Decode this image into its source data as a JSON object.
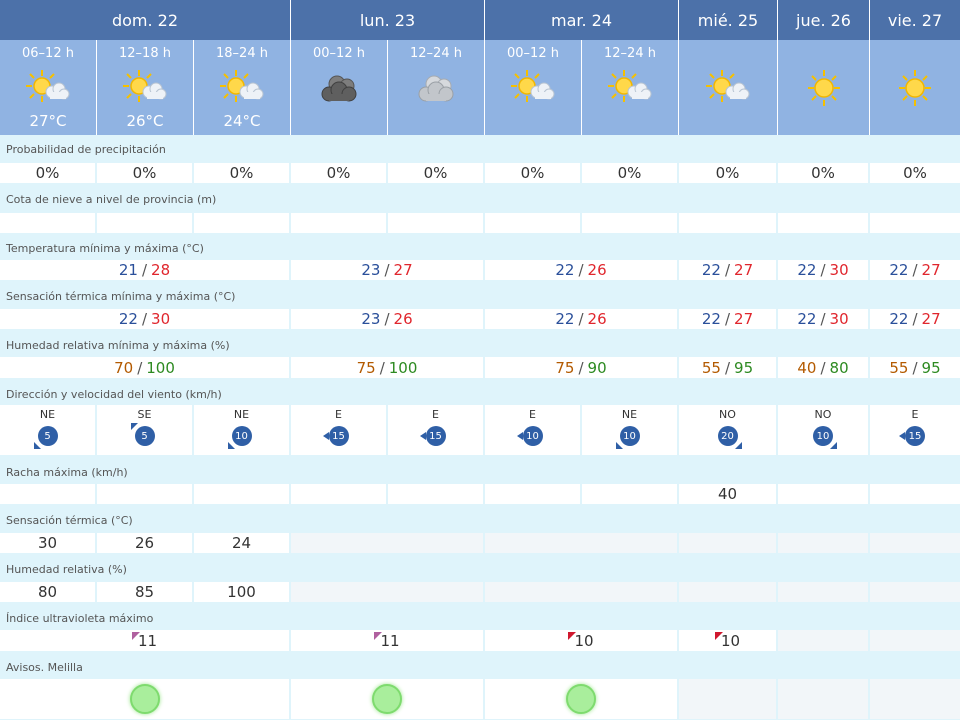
{
  "days": [
    {
      "label": "dom. 22"
    },
    {
      "label": "lun. 23"
    },
    {
      "label": "mar. 24"
    },
    {
      "label": "mié. 25"
    },
    {
      "label": "jue. 26"
    },
    {
      "label": "vie. 27"
    }
  ],
  "periods": [
    {
      "label": "06–12 h",
      "icon": "sun-cloud-icon",
      "temp": "27°C"
    },
    {
      "label": "12–18 h",
      "icon": "sun-cloud-icon",
      "temp": "26°C"
    },
    {
      "label": "18–24 h",
      "icon": "sun-cloud-icon",
      "temp": "24°C"
    },
    {
      "label": "00–12 h",
      "icon": "dark-clouds-icon",
      "temp": ""
    },
    {
      "label": "12–24 h",
      "icon": "grey-clouds-icon",
      "temp": ""
    },
    {
      "label": "00–12 h",
      "icon": "sun-cloud-icon",
      "temp": ""
    },
    {
      "label": "12–24 h",
      "icon": "sun-cloud-icon",
      "temp": ""
    },
    {
      "label": "",
      "icon": "sun-cloud-icon",
      "temp": ""
    },
    {
      "label": "",
      "icon": "sun-icon",
      "temp": ""
    },
    {
      "label": "",
      "icon": "sun-icon",
      "temp": ""
    }
  ],
  "sections": {
    "precip": "Probabilidad de precipitación",
    "snow": "Cota de nieve a nivel de provincia (m)",
    "temp": "Temperatura mínima y máxima (°C)",
    "feel": "Sensación térmica mínima y máxima (°C)",
    "humid": "Humedad relativa mínima y máxima (%)",
    "wind": "Dirección y velocidad del viento (km/h)",
    "gust": "Racha máxima (km/h)",
    "feel_hourly": "Sensación térmica (°C)",
    "humid_hourly": "Humedad relativa (%)",
    "uv": "Índice ultravioleta máximo",
    "warnings": "Avisos. Melilla"
  },
  "precip": [
    "0%",
    "0%",
    "0%",
    "0%",
    "0%",
    "0%",
    "0%",
    "0%",
    "0%",
    "0%"
  ],
  "temp": [
    {
      "min": "21",
      "max": "28"
    },
    {
      "min": "23",
      "max": "27"
    },
    {
      "min": "22",
      "max": "26"
    },
    {
      "min": "22",
      "max": "27"
    },
    {
      "min": "22",
      "max": "30"
    },
    {
      "min": "22",
      "max": "27"
    }
  ],
  "feel": [
    {
      "min": "22",
      "max": "30"
    },
    {
      "min": "23",
      "max": "26"
    },
    {
      "min": "22",
      "max": "26"
    },
    {
      "min": "22",
      "max": "27"
    },
    {
      "min": "22",
      "max": "30"
    },
    {
      "min": "22",
      "max": "27"
    }
  ],
  "humid": [
    {
      "min": "70",
      "max": "100"
    },
    {
      "min": "75",
      "max": "100"
    },
    {
      "min": "75",
      "max": "90"
    },
    {
      "min": "55",
      "max": "95"
    },
    {
      "min": "40",
      "max": "80"
    },
    {
      "min": "55",
      "max": "95"
    }
  ],
  "wind": [
    {
      "dir": "NE",
      "speed": "5"
    },
    {
      "dir": "SE",
      "speed": "5"
    },
    {
      "dir": "NE",
      "speed": "10"
    },
    {
      "dir": "E",
      "speed": "15"
    },
    {
      "dir": "E",
      "speed": "15"
    },
    {
      "dir": "E",
      "speed": "10"
    },
    {
      "dir": "NE",
      "speed": "10"
    },
    {
      "dir": "NO",
      "speed": "20"
    },
    {
      "dir": "NO",
      "speed": "10"
    },
    {
      "dir": "E",
      "speed": "15"
    }
  ],
  "gust": [
    "",
    "",
    "",
    "",
    "",
    "",
    "",
    "40",
    "",
    ""
  ],
  "feel_hourly": [
    "30",
    "26",
    "24"
  ],
  "humid_hourly": [
    "80",
    "85",
    "100"
  ],
  "uv": [
    {
      "value": "11",
      "color": "#b0609f"
    },
    {
      "value": "11",
      "color": "#b0609f"
    },
    {
      "value": "10",
      "color": "#d0182e"
    },
    {
      "value": "10",
      "color": "#d0182e"
    }
  ],
  "warnings": [
    {
      "level": "green",
      "color": "#a9ee9c"
    },
    {
      "level": "green",
      "color": "#a9ee9c"
    },
    {
      "level": "green",
      "color": "#a9ee9c"
    }
  ]
}
